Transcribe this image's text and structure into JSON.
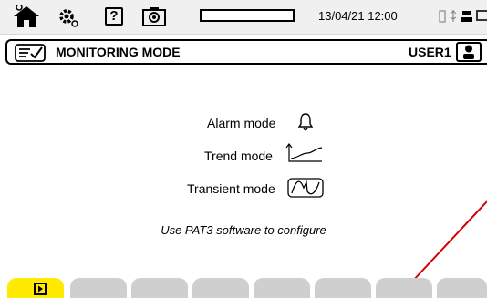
{
  "statusbar": {
    "icons": [
      "home-icon",
      "gear-icon",
      "help-icon",
      "camera-icon",
      "usb-icon",
      "battery-icon"
    ],
    "help_label": "?",
    "progress": 0,
    "datetime": "13/04/21 12:00"
  },
  "titlebar": {
    "title": "MONITORING MODE",
    "user": "USER1"
  },
  "modes": [
    {
      "label": "Alarm mode",
      "icon": "bell-icon"
    },
    {
      "label": "Trend mode",
      "icon": "trend-graph-icon"
    },
    {
      "label": "Transient mode",
      "icon": "transient-wave-icon"
    }
  ],
  "note": "Use PAT3 software to configure",
  "annotation": {
    "color": "#d40000"
  },
  "tabs": {
    "count": 8,
    "active_index": 0,
    "active_color": "#ffea00",
    "inactive_color": "#cfcfcf",
    "active_icon": "play-icon"
  }
}
